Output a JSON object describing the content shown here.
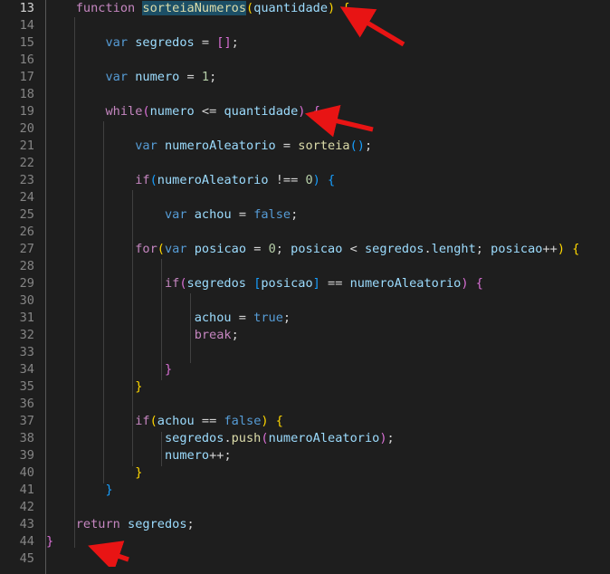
{
  "editor": {
    "title": "code-editor",
    "language": "javascript",
    "theme": "dark-plus",
    "background_color": "#1e1e1e",
    "active_line": 13,
    "first_visible_line": 13,
    "last_visible_line": 45,
    "line_height_px": 19,
    "font_size_px": 13.6,
    "selection_text": "sorteiaNumeros",
    "selection_color": "#1c4f66",
    "gutter": {
      "divider_color": "#585858",
      "line_number_color": "#858585",
      "active_line_number_color": "#d4d4d4",
      "line_numbers": [
        13,
        14,
        15,
        16,
        17,
        18,
        19,
        20,
        21,
        22,
        23,
        24,
        25,
        26,
        27,
        28,
        29,
        30,
        31,
        32,
        33,
        34,
        35,
        36,
        37,
        38,
        39,
        40,
        41,
        42,
        43,
        44,
        45
      ]
    },
    "palette": {
      "default": "#d4d4d4",
      "keyword": "#569cd6",
      "control": "#c586c0",
      "function": "#dcdcaa",
      "variable": "#9cdcfe",
      "number": "#b5cea8",
      "bracket_level_1": "#ffd700",
      "bracket_level_2": "#da70d6",
      "bracket_level_3": "#179fff",
      "indent_guide": "#404040",
      "annotation_arrow": "#e81414"
    },
    "code_lines": [
      {
        "number": 13,
        "text": "    function sorteiaNumeros(quantidade) {"
      },
      {
        "number": 14,
        "text": ""
      },
      {
        "number": 15,
        "text": "        var segredos = [];"
      },
      {
        "number": 16,
        "text": ""
      },
      {
        "number": 17,
        "text": "        var numero = 1;"
      },
      {
        "number": 18,
        "text": ""
      },
      {
        "number": 19,
        "text": "        while(numero <= quantidade) {"
      },
      {
        "number": 20,
        "text": ""
      },
      {
        "number": 21,
        "text": "            var numeroAleatorio = sorteia();"
      },
      {
        "number": 22,
        "text": ""
      },
      {
        "number": 23,
        "text": "            if(numeroAleatorio !== 0) {"
      },
      {
        "number": 24,
        "text": ""
      },
      {
        "number": 25,
        "text": "                var achou = false;"
      },
      {
        "number": 26,
        "text": ""
      },
      {
        "number": 27,
        "text": "            for(var posicao = 0; posicao < segredos.lenght; posicao++) {"
      },
      {
        "number": 28,
        "text": ""
      },
      {
        "number": 29,
        "text": "                if(segredos [posicao] == numeroAleatorio) {"
      },
      {
        "number": 30,
        "text": ""
      },
      {
        "number": 31,
        "text": "                    achou = true;"
      },
      {
        "number": 32,
        "text": "                    break;"
      },
      {
        "number": 33,
        "text": ""
      },
      {
        "number": 34,
        "text": "                }"
      },
      {
        "number": 35,
        "text": "            }"
      },
      {
        "number": 36,
        "text": ""
      },
      {
        "number": 37,
        "text": "            if(achou == false) {"
      },
      {
        "number": 38,
        "text": "                segredos.push(numeroAleatorio);"
      },
      {
        "number": 39,
        "text": "                numero++;"
      },
      {
        "number": 40,
        "text": "            }"
      },
      {
        "number": 41,
        "text": "        }"
      },
      {
        "number": 42,
        "text": ""
      },
      {
        "number": 43,
        "text": "    return segredos;"
      },
      {
        "number": 44,
        "text": "}"
      },
      {
        "number": 45,
        "text": ""
      }
    ],
    "annotations": [
      {
        "name": "arrow-function-open-brace",
        "points_to_line": 13,
        "color": "#e81414"
      },
      {
        "name": "arrow-while-open-brace",
        "points_to_line": 19,
        "color": "#e81414"
      },
      {
        "name": "arrow-function-close-brace",
        "points_to_line": 44,
        "color": "#e81414"
      }
    ]
  }
}
